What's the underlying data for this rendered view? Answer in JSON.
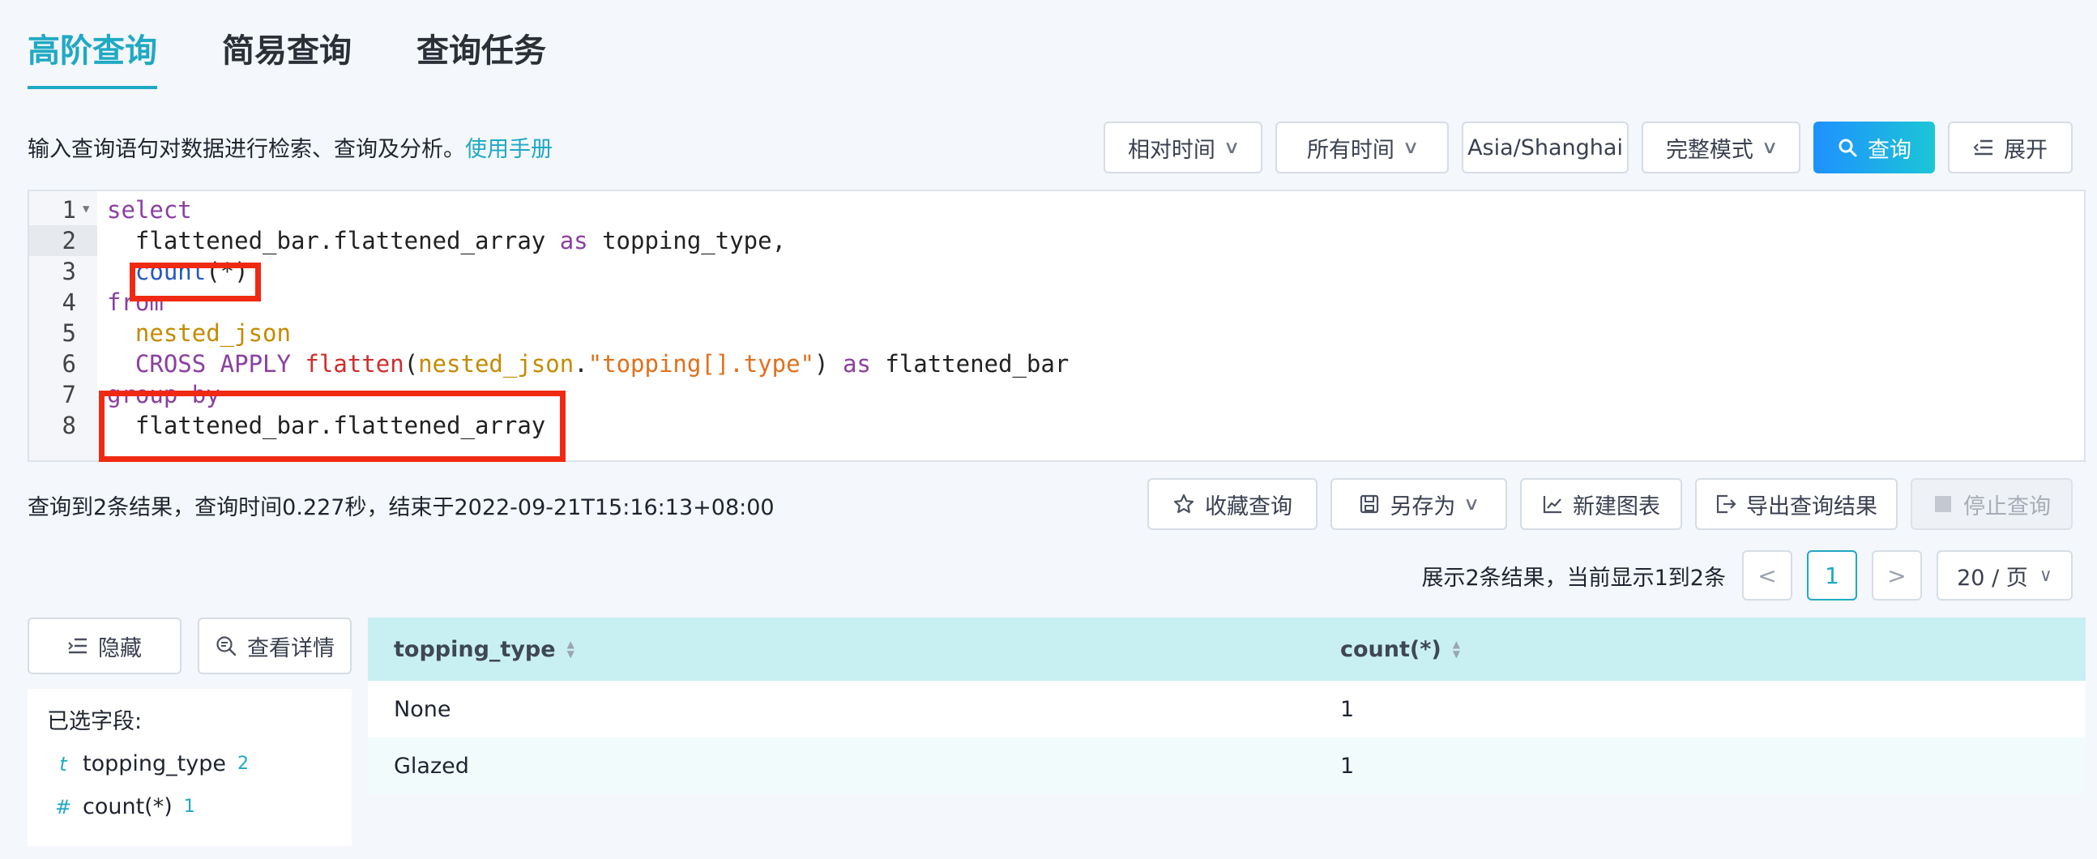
{
  "tabs": [
    {
      "label": "高阶查询",
      "active": true
    },
    {
      "label": "简易查询",
      "active": false
    },
    {
      "label": "查询任务",
      "active": false
    }
  ],
  "hint": {
    "text": "输入查询语句对数据进行检索、查询及分析。",
    "link": "使用手册"
  },
  "toolbar": {
    "relative_time": "相对时间",
    "all_time": "所有时间",
    "timezone": "Asia/Shanghai",
    "mode": "完整模式",
    "query": "查询",
    "expand": "展开"
  },
  "editor": {
    "line_numbers": [
      "1",
      "2",
      "3",
      "4",
      "5",
      "6",
      "7",
      "8"
    ],
    "current_line": 2,
    "lines": [
      [
        {
          "t": "select",
          "c": "kw"
        }
      ],
      [
        {
          "t": "  flattened_bar.flattened_array ",
          "c": ""
        },
        {
          "t": "as",
          "c": "kw"
        },
        {
          "t": " topping_type,",
          "c": ""
        }
      ],
      [
        {
          "t": "  ",
          "c": ""
        },
        {
          "t": "count",
          "c": "kw2"
        },
        {
          "t": "(*)",
          "c": ""
        }
      ],
      [
        {
          "t": "from",
          "c": "kw"
        }
      ],
      [
        {
          "t": "  nested_json",
          "c": "ident"
        }
      ],
      [
        {
          "t": "  CROSS APPLY ",
          "c": "kw"
        },
        {
          "t": "flatten",
          "c": "fn"
        },
        {
          "t": "(",
          "c": ""
        },
        {
          "t": "nested_json",
          "c": "ident"
        },
        {
          "t": ".",
          "c": ""
        },
        {
          "t": "\"topping[].type\"",
          "c": "str"
        },
        {
          "t": ") ",
          "c": ""
        },
        {
          "t": "as",
          "c": "kw"
        },
        {
          "t": " flattened_bar",
          "c": ""
        }
      ],
      [
        {
          "t": "group by",
          "c": "kw"
        }
      ],
      [
        {
          "t": "  flattened_bar.flattened_array",
          "c": ""
        }
      ]
    ]
  },
  "status": {
    "text": "查询到2条结果，查询时间0.227秒，结束于2022-09-21T15:16:13+08:00"
  },
  "actions": {
    "favorite": "收藏查询",
    "save_as": "另存为",
    "new_chart": "新建图表",
    "export": "导出查询结果",
    "stop": "停止查询"
  },
  "pager": {
    "info": "展示2条结果，当前显示1到2条",
    "prev": "<",
    "page": "1",
    "next": ">",
    "page_size": "20 / 页"
  },
  "side": {
    "hide": "隐藏",
    "details": "查看详情",
    "selected_title": "已选字段:",
    "fields": [
      {
        "type": "t",
        "name": "topping_type",
        "count": "2"
      },
      {
        "type": "#",
        "name": "count(*)",
        "count": "1"
      }
    ]
  },
  "table": {
    "columns": [
      "topping_type",
      "count(*)"
    ],
    "rows": [
      [
        "None",
        "1"
      ],
      [
        "Glazed",
        "1"
      ]
    ]
  },
  "colors": {
    "accent": "#1fa9c4",
    "annotation": "#f02a12"
  }
}
